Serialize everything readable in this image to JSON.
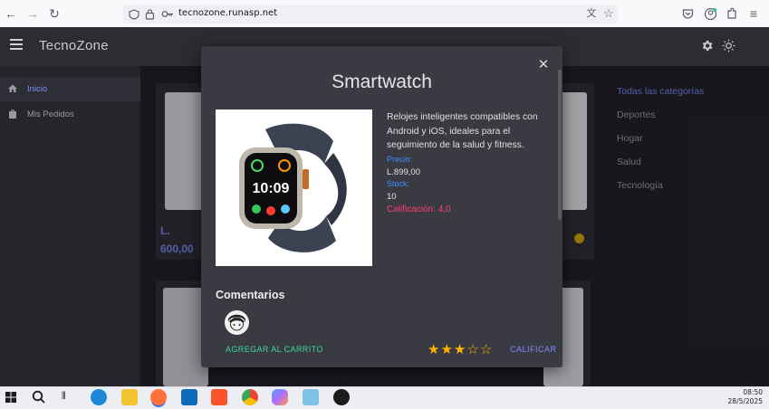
{
  "browser": {
    "url": "tecnozone.runasp.net"
  },
  "app": {
    "title": "TecnoZone",
    "sidebar": [
      {
        "label": "Inicio"
      },
      {
        "label": "Mis Pedidos"
      }
    ],
    "categories": [
      "Todas las categorías",
      "Deportes",
      "Hogar",
      "Salud",
      "Tecnología"
    ],
    "background_cards": [
      {
        "price_prefix": "L.",
        "price": "600,00"
      }
    ]
  },
  "modal": {
    "title": "Smartwatch",
    "description": "Relojes inteligentes compatibles con Android y iOS, ideales para el seguimiento de la salud y fitness.",
    "price_label": "Precio:",
    "price_value": "L.899,00",
    "stock_label": "Stock:",
    "stock_value": "10",
    "rating_text": "Calificación: 4,0",
    "comments_title": "Comentarios",
    "add_to_cart_label": "AGREGAR AL CARRITO",
    "rate_label": "CALIFICAR",
    "user_rating": 3,
    "max_rating": 5,
    "watch_time": "10:09"
  },
  "taskbar": {
    "time": "08:50",
    "date": "28/5/2025"
  },
  "colors": {
    "accent_blue": "#7f8cff",
    "green": "#3ddc97",
    "rating_pink": "#ff3d71",
    "label_blue": "#3d8dff",
    "star": "#ffb400"
  }
}
